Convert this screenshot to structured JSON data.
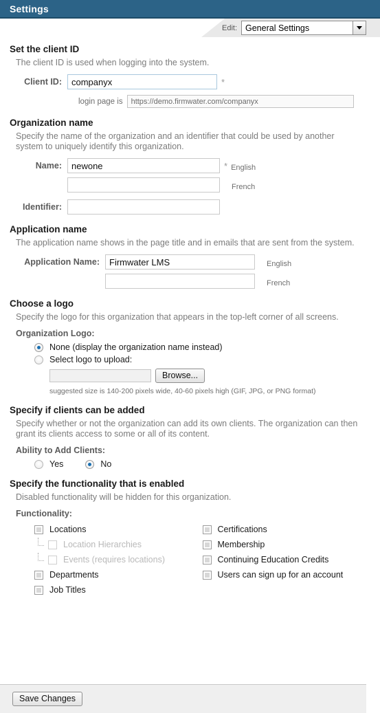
{
  "titlebar": {
    "title": "Settings"
  },
  "editbar": {
    "label": "Edit:",
    "selected_option": "General Settings",
    "options": [
      "General Settings"
    ]
  },
  "sections": {
    "client_id": {
      "heading": "Set the client ID",
      "description": "The client ID is used when logging into the system.",
      "field_label": "Client ID:",
      "field_value": "companyx",
      "required_marker": "*",
      "login_prefix": "login page is",
      "login_url": "https://demo.firmwater.com/companyx"
    },
    "organization_name": {
      "heading": "Organization name",
      "description": "Specify the name of the organization and an identifier that could be used by another system to uniquely identify this organization.",
      "name_label": "Name:",
      "name_value_english": "newone",
      "name_value_french": "",
      "required_marker": "*",
      "lang_english": "English",
      "lang_french": "French",
      "identifier_label": "Identifier:",
      "identifier_value": ""
    },
    "application_name": {
      "heading": "Application name",
      "description": "The application name shows in the page title and in emails that are sent from the system.",
      "field_label": "Application Name:",
      "value_english": "Firmwater LMS",
      "value_french": "",
      "lang_english": "English",
      "lang_french": "French"
    },
    "logo": {
      "heading": "Choose a logo",
      "description": "Specify the logo for this organization that appears in the top-left corner of all screens.",
      "sub_label": "Organization Logo:",
      "option_none": "None (display the organization name instead)",
      "option_upload": "Select logo to upload:",
      "selected": "none",
      "file_value": "",
      "browse_label": "Browse...",
      "hint": "suggested size is 140-200 pixels wide, 40-60 pixels high (GIF, JPG, or PNG format)"
    },
    "clients": {
      "heading": "Specify if clients can be added",
      "description": "Specify whether or not the organization can add its own clients. The organization can then grant its clients access to some or all of its content.",
      "sub_label": "Ability to Add Clients:",
      "option_yes": "Yes",
      "option_no": "No",
      "selected": "no"
    },
    "functionality": {
      "heading": "Specify the functionality that is enabled",
      "description": "Disabled functionality will be hidden for this organization.",
      "sub_label": "Functionality:",
      "left_column": [
        {
          "label": "Locations",
          "checked": false,
          "disabled": false,
          "child": false
        },
        {
          "label": "Location Hierarchies",
          "checked": false,
          "disabled": true,
          "child": true
        },
        {
          "label": "Events (requires locations)",
          "checked": false,
          "disabled": true,
          "child": true
        },
        {
          "label": "Departments",
          "checked": false,
          "disabled": false,
          "child": false
        },
        {
          "label": "Job Titles",
          "checked": false,
          "disabled": false,
          "child": false
        }
      ],
      "right_column": [
        {
          "label": "Certifications",
          "checked": false,
          "disabled": false,
          "child": false
        },
        {
          "label": "Membership",
          "checked": false,
          "disabled": false,
          "child": false
        },
        {
          "label": "Continuing Education Credits",
          "checked": false,
          "disabled": false,
          "child": false
        },
        {
          "label": "Users can sign up for an account",
          "checked": false,
          "disabled": false,
          "child": false
        }
      ]
    }
  },
  "footer": {
    "save_label": "Save Changes"
  },
  "colors": {
    "header_blue": "#2c6387",
    "header_border": "#1d4b68",
    "radio_dot": "#1a6fb0",
    "heading_text": "#1a1a1a",
    "description_text": "#7c7c7c",
    "label_text": "#5b5b5b",
    "footer_bg": "#efefef"
  }
}
